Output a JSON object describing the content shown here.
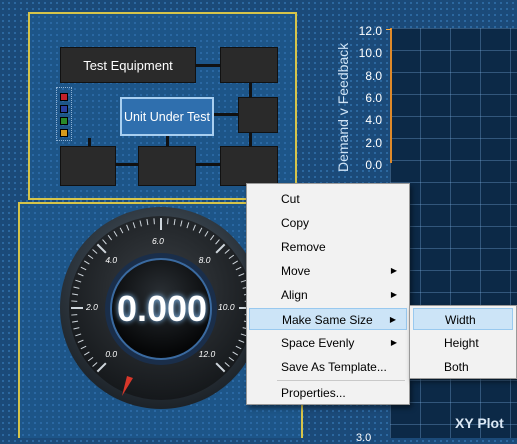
{
  "diagram": {
    "test_equipment": "Test Equipment",
    "unit_under_test": "Unit Under Test",
    "legend_colors": [
      "#c0212a",
      "#2a3fa0",
      "#2a8a2a",
      "#d69a1c"
    ]
  },
  "gauge": {
    "value": "0.000",
    "tick_labels": [
      "0.0",
      "2.0",
      "4.0",
      "6.0",
      "8.0",
      "10.0",
      "12.0"
    ]
  },
  "chart": {
    "ylabel": "Demand v Feedback",
    "yticks": [
      "12.0",
      "10.0",
      "8.0",
      "6.0",
      "4.0",
      "2.0",
      "0.0"
    ],
    "xy_title": "XY Plot",
    "bottom_tick": "3.0"
  },
  "context_menu": {
    "items": [
      {
        "label": "Cut",
        "submenu": false
      },
      {
        "label": "Copy",
        "submenu": false
      },
      {
        "label": "Remove",
        "submenu": false
      },
      {
        "label": "Move",
        "submenu": true
      },
      {
        "label": "Align",
        "submenu": true
      },
      {
        "label": "Make Same Size",
        "submenu": true
      },
      {
        "label": "Space Evenly",
        "submenu": true
      },
      {
        "label": "Save As Template...",
        "submenu": false
      },
      {
        "label": "Properties...",
        "submenu": false
      }
    ],
    "highlighted": "Make Same Size"
  },
  "submenu": {
    "items": [
      "Width",
      "Height",
      "Both"
    ],
    "highlighted": "Width"
  }
}
